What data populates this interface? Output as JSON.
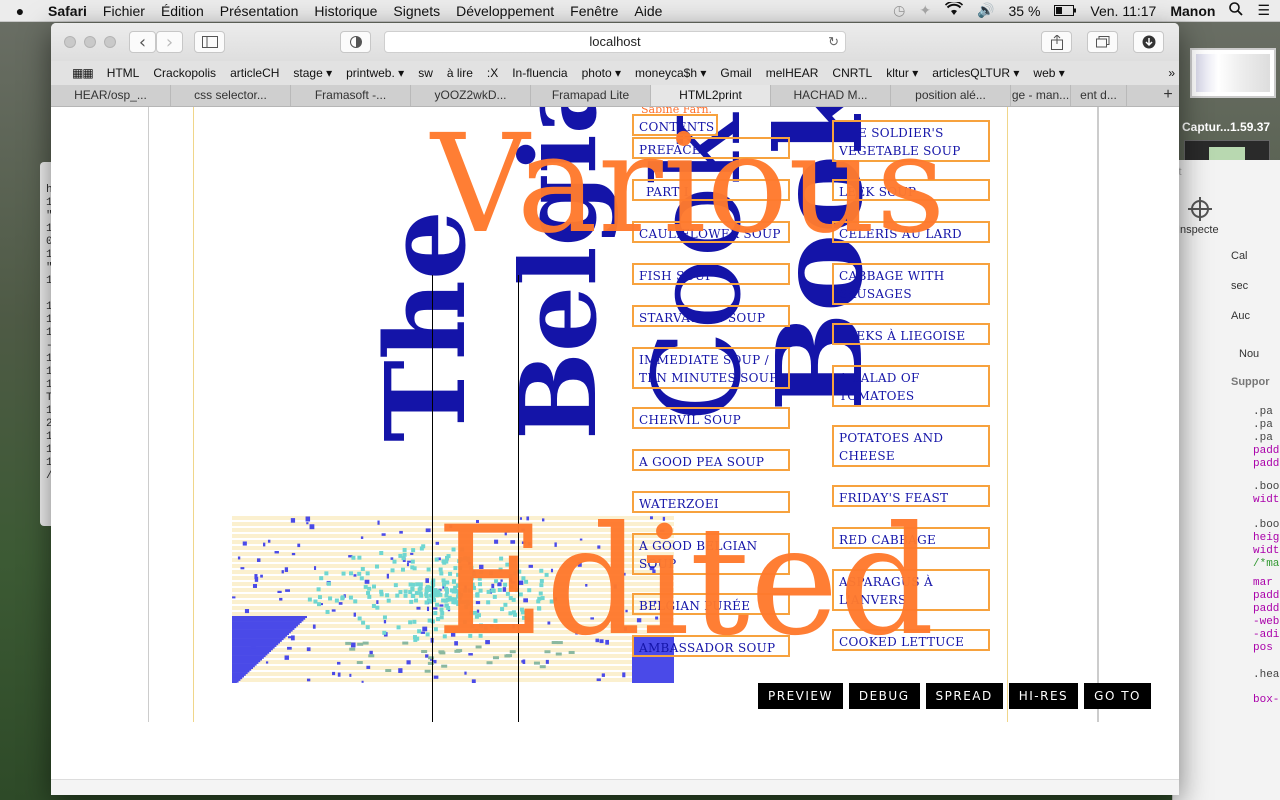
{
  "menubar": {
    "apple": "",
    "app": "Safari",
    "items": [
      "Fichier",
      "Édition",
      "Présentation",
      "Historique",
      "Signets",
      "Développement",
      "Fenêtre",
      "Aide"
    ],
    "battery": "35 %",
    "clock": "Ven. 11:17",
    "user": "Manon"
  },
  "toolbar": {
    "back": "‹",
    "forward": "›",
    "url": "localhost",
    "reload": "↻"
  },
  "bookmarks": [
    "HTML",
    "Crackopolis",
    "articleCH",
    "stage ▾",
    "printweb. ▾",
    "sw",
    "à lire",
    ":X",
    "In-fluencia",
    "photo ▾",
    "moneyca$h ▾",
    "Gmail",
    "melHEAR",
    "CNRTL",
    "kltur ▾",
    "articlesQLTUR ▾",
    "web ▾"
  ],
  "bookmarks_more": "»",
  "tabs": [
    {
      "label": "HEAR/osp_..."
    },
    {
      "label": "css selector..."
    },
    {
      "label": "Framasoft -..."
    },
    {
      "label": "yOOZ2wkD..."
    },
    {
      "label": "Framapad Lite"
    },
    {
      "label": "HTML2print"
    },
    {
      "label": "HACHAD M..."
    },
    {
      "label": "position alé..."
    },
    {
      "label": "ge - man..."
    },
    {
      "label": "ent d..."
    }
  ],
  "tabs_plus": "+",
  "book": {
    "title_words": [
      "The",
      "Belgian",
      "Cook",
      "Book"
    ],
    "author_fragment": "Sabine Farn.",
    "overlay_various": "Various",
    "overlay_edited": "Edited",
    "toc_left": [
      "Contents",
      "Preface",
      "Part I",
      "Cauliflower Soup",
      "Fish Soup",
      "Starvation Soup",
      "Immediate Soup / Ten Minutes Soup",
      "Chervil Soup",
      "A Good Pea Soup",
      "Waterzoei",
      "A Good Belgian Soup",
      "Belgian Purée",
      "Ambassador Soup"
    ],
    "toc_right": [
      "The Soldier's Vegetable Soup",
      "Leek Soup",
      "Celeris au Lard",
      "Cabbage with Sausages",
      "Leeks à Liegoise",
      "A Salad of Tomatoes",
      "Potatoes and Cheese",
      "Friday's Feast",
      "Red Cabbage",
      "Asparagus à l'Anvers",
      "Cooked Lettuce"
    ]
  },
  "controls": [
    "Preview",
    "Debug",
    "Spread",
    "Hi-Res",
    "Go to"
  ],
  "background": {
    "screenshot_label": "Captur...1.59.37",
    "inspector": {
      "inspect_label": "Inspecte",
      "c_label": "Cal",
      "sec": "sec",
      "aucun": "Auc",
      "nouv": "Nou",
      "support": "Suppor",
      "rules": [
        ".pa",
        ".pa",
        ".pa",
        "padd",
        "padd",
        ".boo",
        "widt",
        ".boo",
        "heig",
        "widt",
        "/*ma",
        "mar",
        "padd",
        "padd",
        "-web",
        "-adi",
        "pos",
        ".hea",
        "box-"
      ]
    },
    "terminal_lines": [
      "h",
      "1",
      "\"",
      "1",
      "0",
      "1",
      "\"",
      "1",
      "",
      "1",
      "1",
      "1",
      "-",
      "1",
      "1",
      "1",
      "T",
      "1",
      "2",
      "1",
      "1",
      "1",
      "/"
    ]
  },
  "colors": {
    "blue": "#1414a8",
    "orange": "#ff7a2e",
    "toc_border": "#f7a23e",
    "pixel_cyan": "#6fd6d0",
    "pixel_blue": "#4a4ae8",
    "pixel_cream": "#fbf0cf"
  }
}
